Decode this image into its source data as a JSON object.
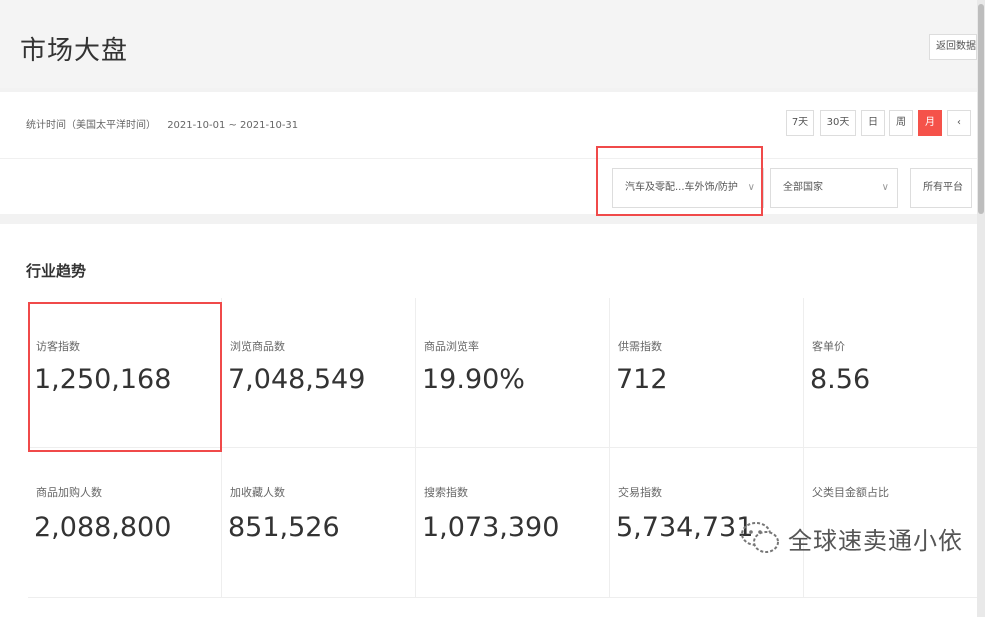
{
  "header": {
    "title": "市场大盘",
    "back_label": "返回数据"
  },
  "filters": {
    "time_label": "统计时间（美国太平洋时间）",
    "time_range": "2021-10-01 ~ 2021-10-31",
    "periods": [
      "7天",
      "30天",
      "日",
      "周",
      "月"
    ],
    "active_period": "月",
    "prev_glyph": "‹",
    "category_value": "汽车及零配...车外饰/防护",
    "country_value": "全部国家",
    "platform_value": "所有平台",
    "chevron": "∨"
  },
  "trend": {
    "section_title": "行业趋势",
    "metrics": [
      {
        "label": "访客指数",
        "value": "1,250,168"
      },
      {
        "label": "浏览商品数",
        "value": "7,048,549"
      },
      {
        "label": "商品浏览率",
        "value": "19.90%"
      },
      {
        "label": "供需指数",
        "value": "712"
      },
      {
        "label": "客单价",
        "value": "8.56"
      },
      {
        "label": "商品加购人数",
        "value": "2,088,800"
      },
      {
        "label": "加收藏人数",
        "value": "851,526"
      },
      {
        "label": "搜索指数",
        "value": "1,073,390"
      },
      {
        "label": "交易指数",
        "value": "5,734,731"
      },
      {
        "label": "父类目金额占比",
        "value": ""
      }
    ]
  },
  "watermark": {
    "text": "全球速卖通小依"
  },
  "colors": {
    "accent": "#f5524a",
    "highlight_border": "#f04a4a"
  }
}
